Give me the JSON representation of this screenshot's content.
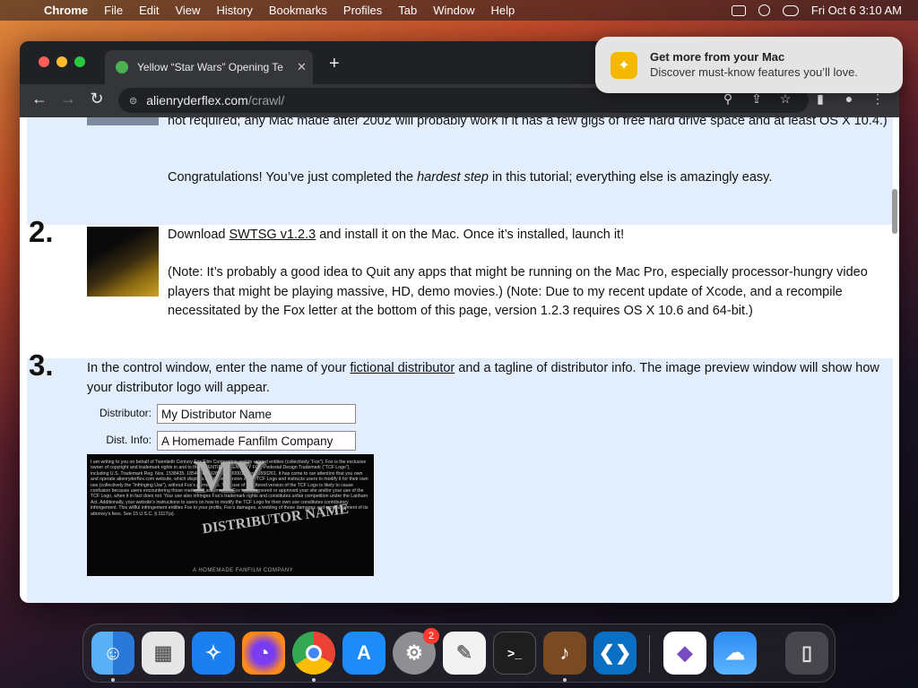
{
  "menubar": {
    "app": "Chrome",
    "items": [
      "File",
      "Edit",
      "View",
      "History",
      "Bookmarks",
      "Profiles",
      "Tab",
      "Window",
      "Help"
    ],
    "clock": "Fri Oct 6  3:10 AM"
  },
  "browser": {
    "tab_title": "Yellow “Star Wars” Opening Te",
    "url_host": "alienryderflex.com",
    "url_path": "/crawl/"
  },
  "notification": {
    "title": "Get more from your Mac",
    "body": "Discover must-know features you’ll love."
  },
  "page": {
    "top_para": "not required; any Mac made after 2002 will probably work if it has a few gigs of free hard drive space and at least OS X 10.4.)",
    "congrats_pre": "Congratulations! You’ve just completed the ",
    "congrats_em": "hardest step",
    "congrats_post": " in this tutorial; everything else is amazingly easy.",
    "step2": {
      "num": "2.",
      "pre": "Download ",
      "link": "SWTSG v1.2.3",
      "post": " and install it on the Mac. Once it’s installed, launch it!",
      "note": "(Note: It’s probably a good idea to Quit any apps that might be running on the Mac Pro, especially processor-hungry video players that might be playing massive, HD, demo movies.) (Note: Due to my recent update of Xcode, and a recompile necessitated by the Fox letter at the bottom of this page, version 1.2.3 requires OS X 10.6 and 64-bit.)"
    },
    "step3": {
      "num": "3.",
      "pre": "In the control window, enter the name of your ",
      "link": "fictional distributor",
      "post": " and a tagline of distributor info. The image preview window will show how your distributor logo will appear.",
      "distributor_label": "Distributor:",
      "distributor_value": "My Distributor Name",
      "info_label": "Dist. Info:",
      "info_value": "A Homemade Fanfilm Company",
      "preview_legal": "I am writing to you on behalf of Twentieth Century Fox Film Corporation and its related entities (collectively “Fox”). Fox is the exclusive owner of copyright and trademark rights in and to the TWENTIETH CENTURY FOX Pedestal Design Trademark (“TCF Logo”), including U.S. Trademark Reg. Nos. 1538435, 1854046, 1928424, 2000013, and 3550261. It has come to our attention that you own and operate alienryderflex.com website, which displays an altered version of the TCF Logo and instructs users to modify it for their own use (collectively the “Infringing Use”), without Fox’s permission. Your use of an altered version of the TCF Logo is likely to cause confusion because users encountering those marks will assume that Fox has sponsored or approved your site and/or your use of the TCF Logo, when it in fact does not. Your use also infringes Fox’s trademark rights and constitutes unfair competition under the Lanham Act. Additionally, your website’s instructions to users on how to modify the TCF Logo for their own use constitutes contributory infringement. This willful infringement entitles Fox to your profits, Fox’s damages, a trebling of those damages and reimbursement of its attorney’s fees. See 15 U.S.C. § 1117(a).",
      "preview_logo_1": "MY",
      "preview_logo_2": "DISTRIBUTOR NAME",
      "preview_sub": "A HOMEMADE FANFILM COMPANY"
    }
  },
  "dock": {
    "badge_count": "2",
    "apps": [
      "finder-icon",
      "launchpad-icon",
      "safari-icon",
      "firefox-icon",
      "chrome-icon",
      "app-store-icon",
      "system-settings-icon",
      "textedit-icon",
      "terminal-icon",
      "garageband-icon",
      "vscode-icon",
      "visual-studio-icon",
      "weather-icon",
      "trash-icon"
    ]
  },
  "colors": {
    "band": "#e3eefc",
    "chrome_bg": "#202124",
    "toolbar": "#35363a"
  }
}
